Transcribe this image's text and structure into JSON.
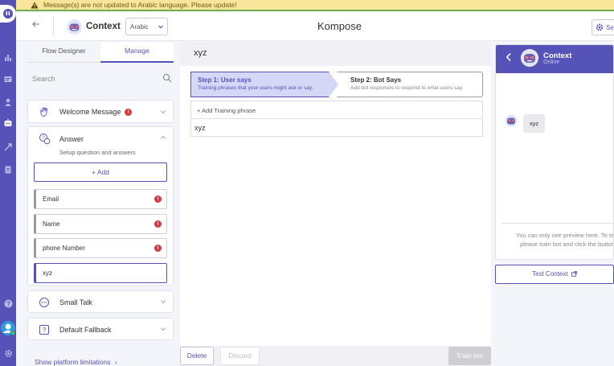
{
  "banner": {
    "text": "Message(s) are not updated to Arabic language. Please update!",
    "icon": "warning-icon"
  },
  "topbar": {
    "bot_name": "Context",
    "language": "Arabic",
    "app_title": "Kompose",
    "settings_label": "Se"
  },
  "left": {
    "tabs": [
      {
        "label": "Flow Designer"
      },
      {
        "label": "Manage"
      }
    ],
    "active_tab": "Manage",
    "search_placeholder": "Search",
    "welcome": {
      "title": "Welcome Message",
      "alert": "!"
    },
    "answer": {
      "title": "Answer",
      "subtitle": "Setup question and answers",
      "add_label": "+ Add"
    },
    "questions": [
      {
        "label": "Email",
        "alert": "!"
      },
      {
        "label": "Name",
        "alert": "!"
      },
      {
        "label": "phone Number",
        "alert": "!"
      },
      {
        "label": "xyz"
      }
    ],
    "small_talk": {
      "title": "Small Talk"
    },
    "fallback": {
      "title": "Default Fallback"
    },
    "limits_link": "Show platform limitations"
  },
  "center": {
    "header": "xyz",
    "step1": {
      "title": "Step 1: User says",
      "desc": "Training phrases that your users might ask or say."
    },
    "step2": {
      "title": "Step 2: Bot Says",
      "desc": "Add bot responses to respond to what users say."
    },
    "add_phrase": "+ Add Training phrase",
    "phrases": [
      "xyz"
    ],
    "delete_label": "Delete",
    "discard_label": "Discard",
    "train_label": "Train bot"
  },
  "preview": {
    "name": "Context",
    "status": "Online",
    "message": "xyz",
    "note_line1": "You can only see preview here. To test",
    "note_line2": "please train bot and click the button",
    "test_label": "Test Context"
  },
  "colors": {
    "accent": "#5553b7",
    "banner_bg": "#fbe59a",
    "alert": "#d9373f"
  }
}
